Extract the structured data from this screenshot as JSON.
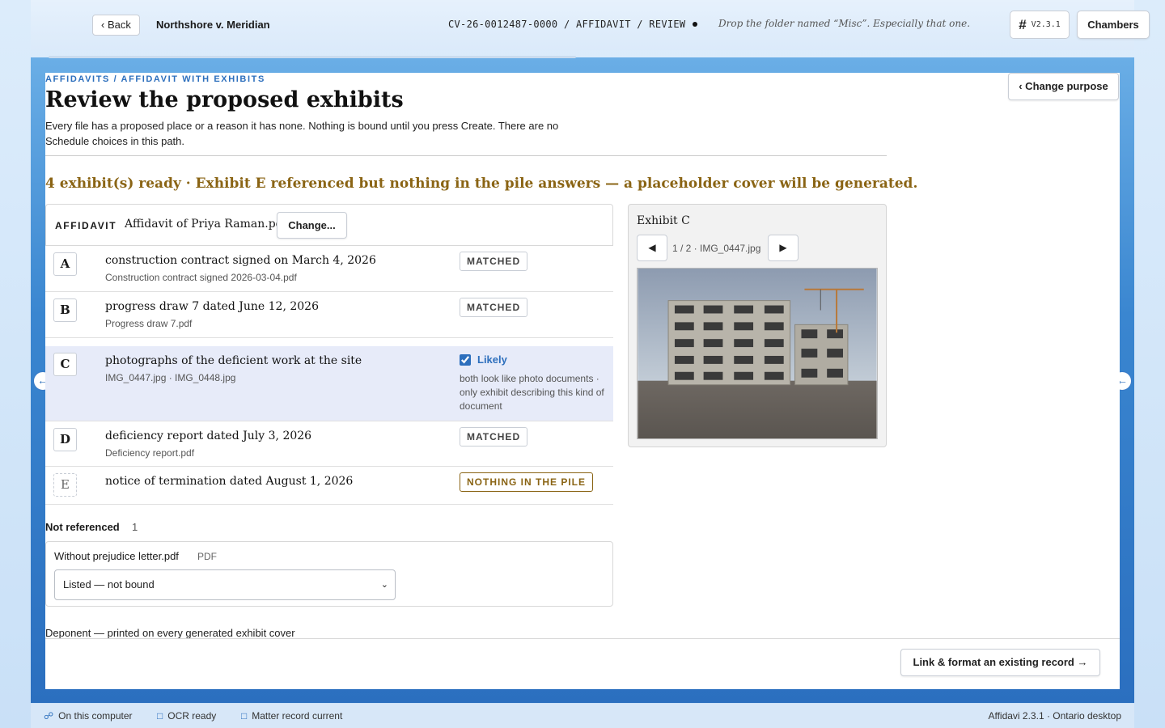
{
  "header": {
    "back_label": "‹ Back",
    "matter_title": "Northshore v. Meridian",
    "breadcrumb": "CV-26-0012487-0000 / AFFIDAVIT / REVIEW",
    "tip": "Drop the folder named “Misc”. Especially that one.",
    "version": "V2.3.1",
    "chambers_label": "Chambers"
  },
  "page": {
    "eyebrow": "AFFIDAVITS / AFFIDAVIT WITH EXHIBITS",
    "title": "Review the proposed exhibits",
    "intro": "Every file has a proposed place or a reason it has none. Nothing is bound until you press Create. There are no Schedule choices in this path.",
    "change_purpose_label": "‹ Change purpose",
    "status_message": "4 exhibit(s) ready · Exhibit E referenced but nothing in the pile answers — a placeholder cover will be generated."
  },
  "affidavit": {
    "label": "AFFIDAVIT",
    "file": "Affidavit of Priya Raman.pdf",
    "change_label": "Change..."
  },
  "exhibits": [
    {
      "letter": "A",
      "description": "construction contract signed on March 4, 2026",
      "file": "Construction contract signed 2026-03-04.pdf",
      "badge": "MATCHED"
    },
    {
      "letter": "B",
      "description": "progress draw 7 dated June 12, 2026",
      "file": "Progress draw 7.pdf",
      "badge": "MATCHED"
    },
    {
      "letter": "C",
      "description": "photographs of the deficient work at the site",
      "file": "IMG_0447.jpg · IMG_0448.jpg",
      "likely_label": "Likely",
      "reason": "both look like photo documents · only exhibit describing this kind of document"
    },
    {
      "letter": "D",
      "description": "deficiency report dated July 3, 2026",
      "file": "Deficiency report.pdf",
      "badge": "MATCHED"
    },
    {
      "letter": "E",
      "description": "notice of termination dated August 1, 2026",
      "badge": "NOTHING IN THE PILE"
    }
  ],
  "not_referenced": {
    "heading": "Not referenced",
    "count": "1",
    "file": "Without prejudice letter.pdf",
    "type": "PDF",
    "selected_option": "Listed — not bound"
  },
  "deponent_label": "Deponent — printed on every generated exhibit cover",
  "preview": {
    "title": "Exhibit C",
    "prev_label": "◀",
    "next_label": "▶",
    "counter": "1 / 2 · IMG_0447.jpg"
  },
  "footer": {
    "link_label": "Link & format an existing record →"
  },
  "statusbar": {
    "items": [
      "On this computer",
      "OCR ready",
      "Matter record current"
    ],
    "app_info": "Affidavi 2.3.1 · Ontario desktop"
  },
  "colors": {
    "accent": "#2d6fbd",
    "warning": "#8a6414",
    "selected_row": "#e7ebf9"
  }
}
